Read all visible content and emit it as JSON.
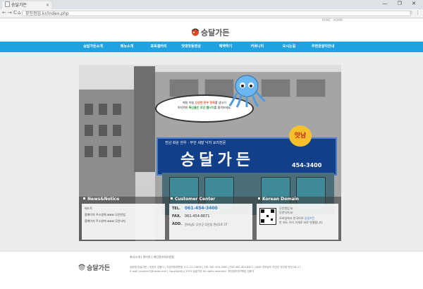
{
  "browser": {
    "tab_title": "승달가든",
    "tab_close": "×",
    "window_controls": "— ❐ ✕",
    "back": "←",
    "forward": "→",
    "reload": "C",
    "home": "⌂",
    "address": "뮤인정입.kr/index.php",
    "bookmark_star": "☆",
    "menu": "⋮"
  },
  "top_links": "HOME · ADMIN",
  "logo_text": "승달가든",
  "nav": [
    {
      "label": "승달가든소개"
    },
    {
      "label": "메뉴소개"
    },
    {
      "label": "포토갤러리"
    },
    {
      "label": "맛대맛동영상"
    },
    {
      "label": "예약하기"
    },
    {
      "label": "커뮤니티"
    },
    {
      "label": "오시는길"
    },
    {
      "label": "주변관광지안내"
    }
  ],
  "hero": {
    "sign_small": "전남 화순 한우 · 무안 세발 낙지 요리전문",
    "sign_big": "승달가든",
    "sign_phone": "454-3400",
    "sign_mat": "맛남",
    "bubble_line1_a": "매일 아침 ",
    "bubble_line1_r": "신선한 한우 정육",
    "bubble_line1_b": "를 생고기",
    "bubble_line2_a": "아지역의 ",
    "bubble_line2_g": "특산물인 무안 뻘낙지",
    "bubble_line2_b": "를 즐겨보세요."
  },
  "news": {
    "title": "News&Notice",
    "items": [
      "테스트",
      "홈페이지 주소창에 www 무안한입",
      "홈페이지 주소창에 www 무안낙지"
    ]
  },
  "customer": {
    "title": "Customer Center",
    "tel_label": "TEL.",
    "tel": "061-454-3400",
    "fax_label": "FAX.",
    "fax": "061-454-8871",
    "add_label": "ADD.",
    "add": "전라남도 무안군 무안읍 면성1로 27"
  },
  "korean_domain": {
    "title": "Korean Domain",
    "line1": "무안한입.kr",
    "line2": "무안낙지.kr",
    "line3_a": "모바일에서 한국어로 ",
    "line3_hl": "승달가든",
    "line4": "만 쳐도 우리 가게로 바로 연결됩니다."
  },
  "footer": {
    "links": "회사소개 | 관리자 | 개인정보처리방침",
    "logo_text": "승달가든",
    "info_line1": "상호명 승달가든 | 대표자 임용식 | 사업자등록번호 411-12-13830 | TEL 061-454-3400 | FAX 061-454-8871 | ADD 전라남도 무안군 무안읍 면성1로 27",
    "info_line2": "E-mail youskim1@naver.com | Copyright(c) 2015 승달가든 All rights reserved. 개인정보관리책임 임용식"
  }
}
